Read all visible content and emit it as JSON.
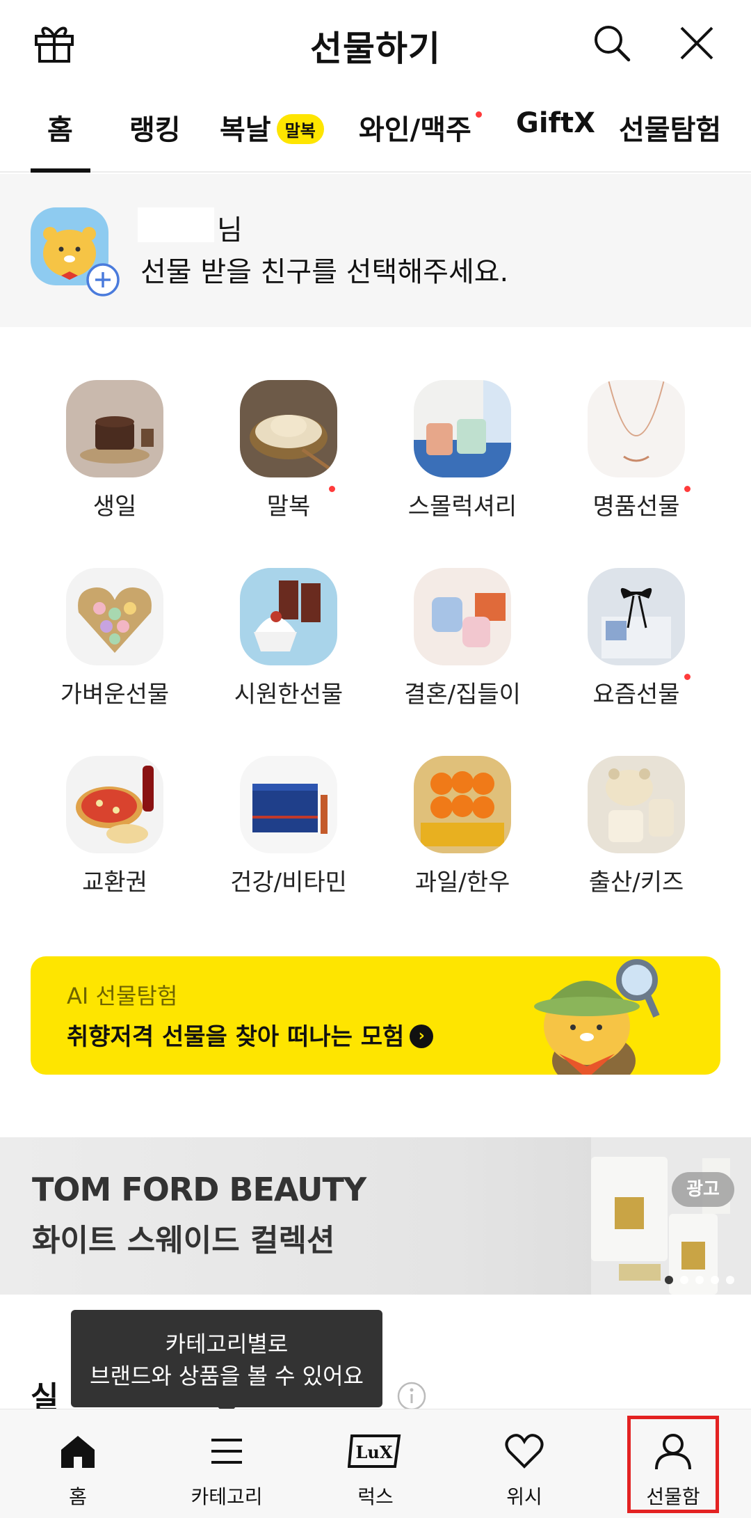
{
  "header": {
    "title": "선물하기",
    "icons": [
      "gift-icon",
      "search-icon",
      "close-icon"
    ]
  },
  "tabs": [
    {
      "label": "홈",
      "active": true
    },
    {
      "label": "랭킹"
    },
    {
      "label": "복날",
      "badge": "말복"
    },
    {
      "label": "와인/맥주",
      "dot": true
    },
    {
      "label": "GiftX"
    },
    {
      "label": "선물탐험"
    }
  ],
  "friend": {
    "suffix": "님",
    "prompt": "선물 받을 친구를 선택해주세요."
  },
  "categories": [
    {
      "label": "생일"
    },
    {
      "label": "말복",
      "dot": true
    },
    {
      "label": "스몰럭셔리"
    },
    {
      "label": "명품선물",
      "dot": true
    },
    {
      "label": "가벼운선물"
    },
    {
      "label": "시원한선물"
    },
    {
      "label": "결혼/집들이"
    },
    {
      "label": "요즘선물",
      "dot": true
    },
    {
      "label": "교환권"
    },
    {
      "label": "건강/비타민"
    },
    {
      "label": "과일/한우"
    },
    {
      "label": "출산/키즈"
    }
  ],
  "ai_banner": {
    "small": "AI 선물탐험",
    "big": "취향저격 선물을 찾아 떠나는 모험",
    "arrow": "›"
  },
  "ad_banner": {
    "brand": "TOM FORD BEAUTY",
    "subtitle": "화이트 스웨이드 컬렉션",
    "ad_label": "광고",
    "carousel_total": 5,
    "carousel_active": 1
  },
  "section": {
    "title_visible": "실"
  },
  "tooltip": {
    "line1": "카테고리별로",
    "line2": "브랜드와 상품을 볼 수 있어요"
  },
  "bottom_nav": [
    {
      "label": "홈",
      "icon": "home-icon"
    },
    {
      "label": "카테고리",
      "icon": "menu-icon"
    },
    {
      "label": "럭스",
      "icon": "lux-icon"
    },
    {
      "label": "위시",
      "icon": "heart-icon"
    },
    {
      "label": "선물함",
      "icon": "person-icon",
      "highlighted": true
    }
  ],
  "colors": {
    "accent_yellow": "#fee500",
    "highlight_red": "#e32222",
    "dot_red": "#ff3b3b"
  }
}
